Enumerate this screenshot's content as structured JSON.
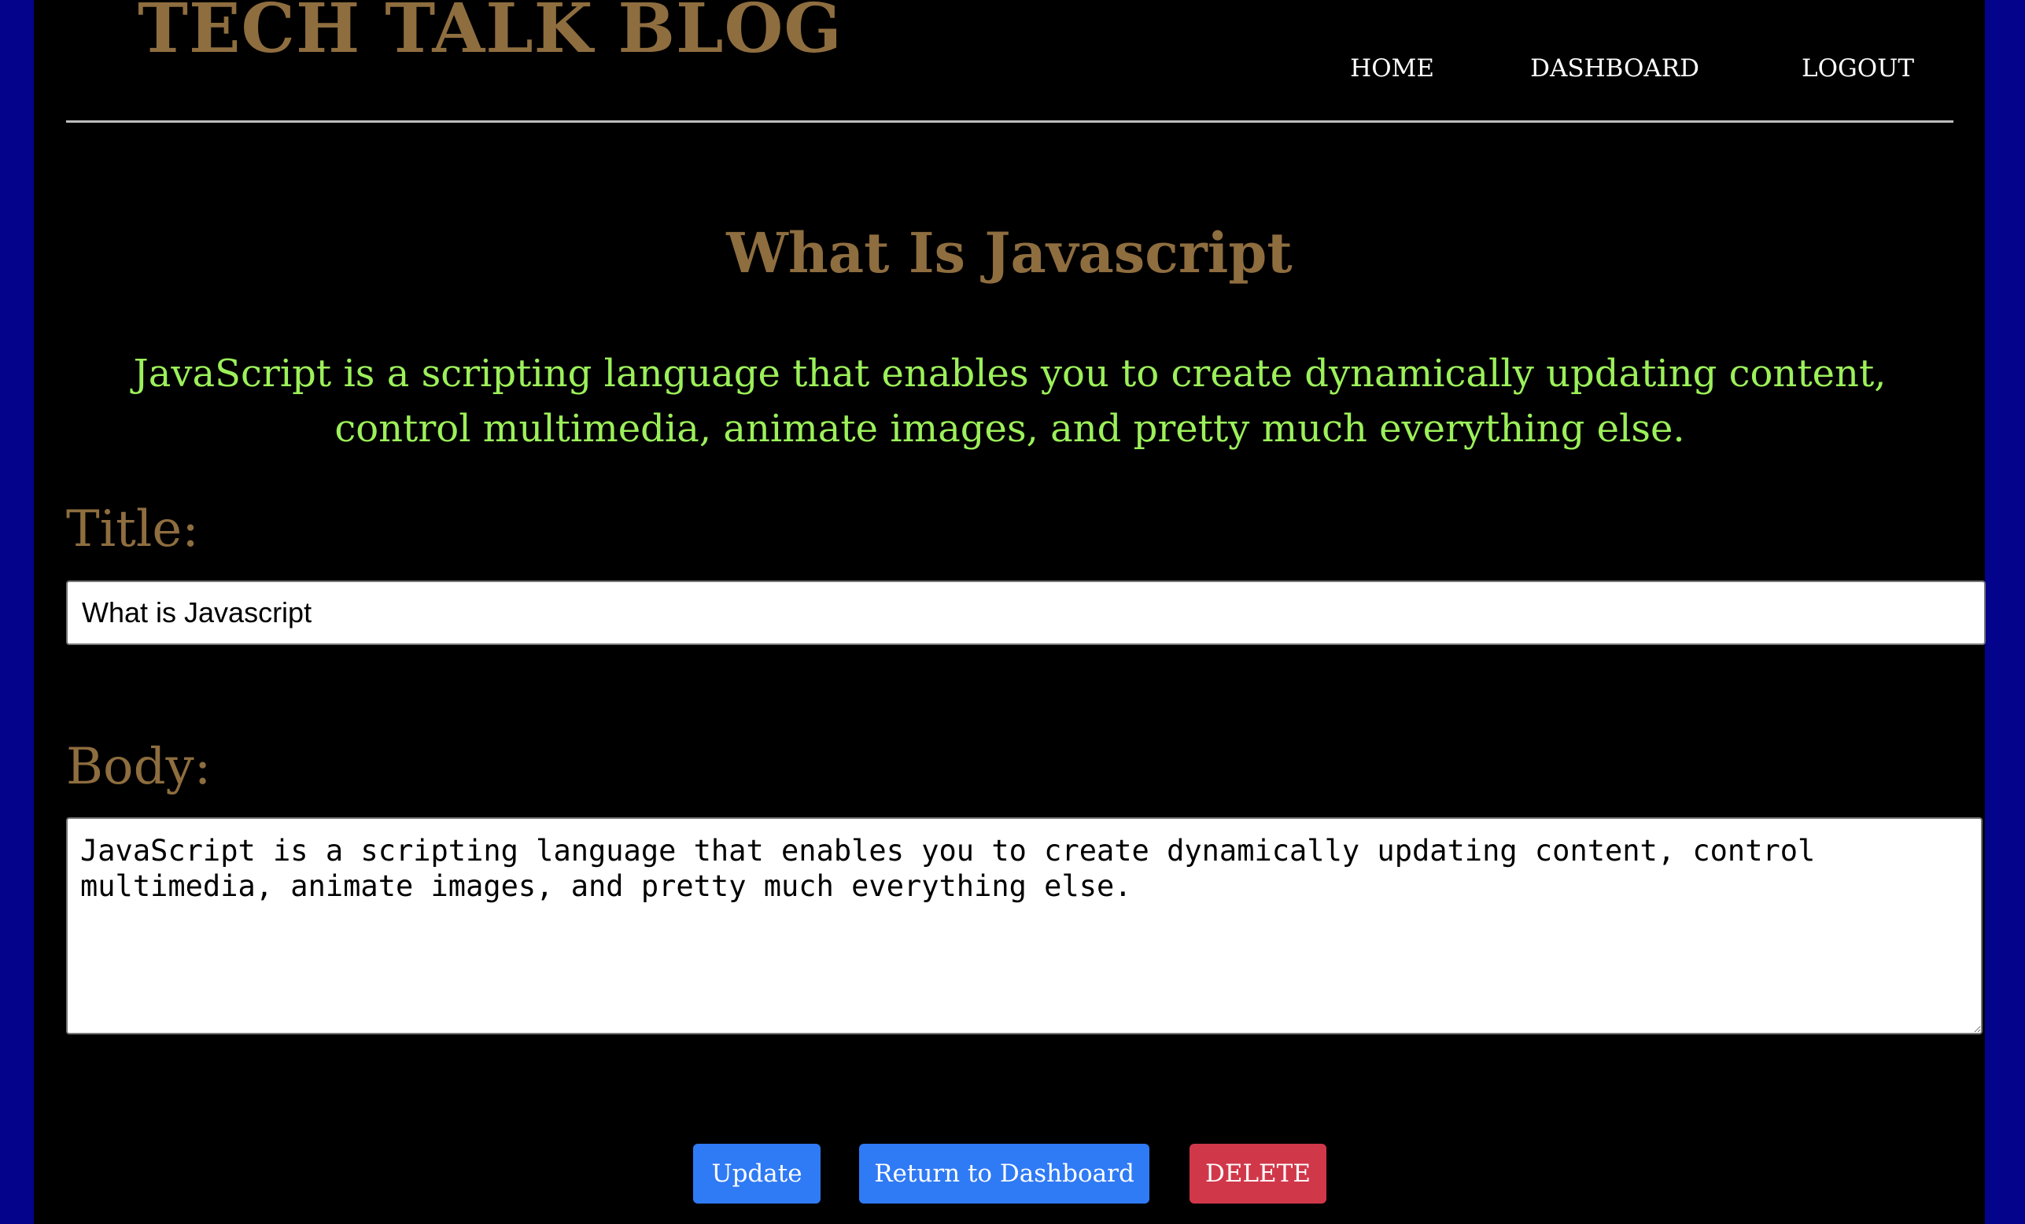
{
  "header": {
    "logo": "TECH TALK BLOG",
    "nav": {
      "home": "HOME",
      "dashboard": "DASHBOARD",
      "logout": "LOGOUT"
    }
  },
  "post": {
    "title": "What Is Javascript",
    "body": "JavaScript is a scripting language that enables you to create dynamically updating content, control multimedia, animate images, and pretty much everything else."
  },
  "form": {
    "title_label": "Title:",
    "title_value": "What is Javascript",
    "body_label": "Body:",
    "body_value": "JavaScript is a scripting language that enables you to create dynamically updating content, control multimedia, animate images, and pretty much everything else."
  },
  "actions": {
    "update": "Update",
    "return": "Return to Dashboard",
    "delete": "DELETE"
  },
  "colors": {
    "brand_gold": "#8e6d3f",
    "body_green": "#9cf05a",
    "primary_blue": "#2f7af5",
    "danger_red": "#d0384a",
    "frame_blue": "#03038c"
  }
}
